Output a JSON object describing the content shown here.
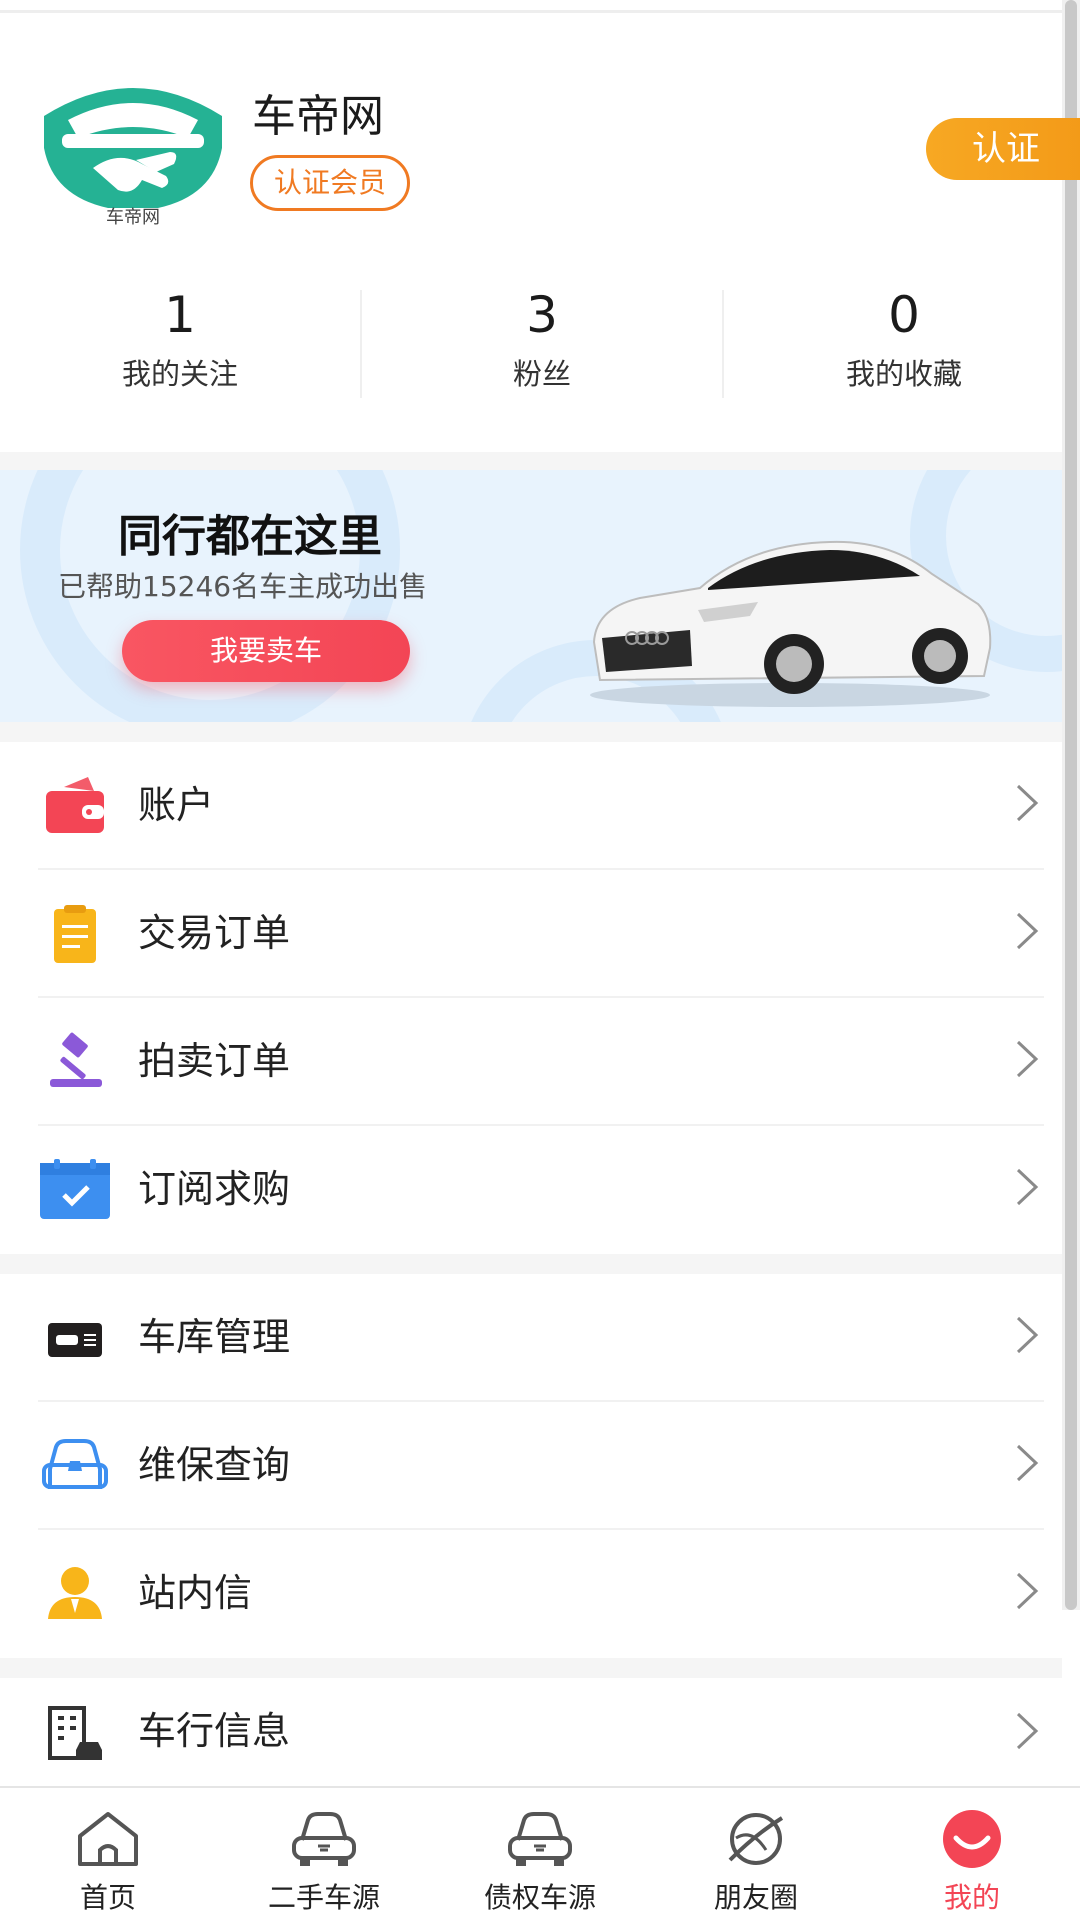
{
  "profile": {
    "logo_text": "车帝网",
    "username": "车帝网",
    "member_badge": "认证会员",
    "certify_button": "认证"
  },
  "stats": [
    {
      "value": "1",
      "label": "我的关注"
    },
    {
      "value": "3",
      "label": "粉丝"
    },
    {
      "value": "0",
      "label": "我的收藏"
    }
  ],
  "banner": {
    "title": "同行都在这里",
    "subtitle": "已帮助15246名车主成功出售",
    "button": "我要卖车"
  },
  "menu_group_1": [
    {
      "label": "账户",
      "icon": "wallet-icon"
    },
    {
      "label": "交易订单",
      "icon": "clipboard-icon"
    },
    {
      "label": "拍卖订单",
      "icon": "gavel-icon"
    },
    {
      "label": "订阅求购",
      "icon": "calendar-check-icon"
    }
  ],
  "menu_group_2": [
    {
      "label": "车库管理",
      "icon": "garage-card-icon"
    },
    {
      "label": "维保查询",
      "icon": "car-maintenance-icon"
    },
    {
      "label": "站内信",
      "icon": "user-message-icon"
    }
  ],
  "menu_group_3": [
    {
      "label": "车行信息",
      "icon": "dealership-icon"
    }
  ],
  "bottom_nav": [
    {
      "label": "首页",
      "icon": "home-icon",
      "active": false
    },
    {
      "label": "二手车源",
      "icon": "car-icon",
      "active": false
    },
    {
      "label": "债权车源",
      "icon": "car-icon",
      "active": false
    },
    {
      "label": "朋友圈",
      "icon": "planet-icon",
      "active": false
    },
    {
      "label": "我的",
      "icon": "smile-icon",
      "active": true
    }
  ],
  "colors": {
    "accent_orange": "#f07a22",
    "certify_orange": "#f7a823",
    "accent_red": "#f34555",
    "logo_teal": "#25b294",
    "banner_bg": "#e8f3fd"
  }
}
